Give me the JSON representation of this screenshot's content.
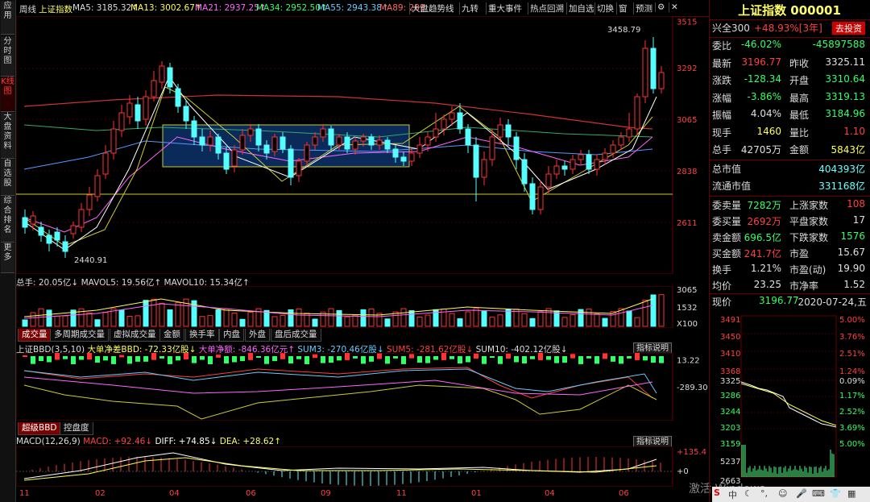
{
  "sidebar": {
    "items": [
      "应用",
      "分时图",
      "K线图",
      "大盘资料",
      "自选股",
      "综合排名",
      "更多"
    ]
  },
  "topbar": {
    "period": "周线",
    "name": "上证指数",
    "ma5": "MA5: 3185.32↑",
    "ma13": "MA13: 3002.67↑",
    "ma21": "MA21: 2937.25↑",
    "ma34": "MA34: 2952.50↑",
    "ma55": "MA55: 2943.38↑",
    "ma89": "MA89: 289",
    "buttons": [
      "大盘趋势线",
      "九转",
      "重大事件",
      "热点回溯",
      "加自选",
      "切换",
      "窗",
      "预测"
    ]
  },
  "main_axis": [
    "3515",
    "3292",
    "3065",
    "2838",
    "2611"
  ],
  "main_annot": {
    "high": "3458.79",
    "low": "2440.91"
  },
  "volume": {
    "title": "总手: 20.05亿↓ MAVOL5: 19.56亿↑ MAVOL10: 15.34亿↑",
    "axis": [
      "3065",
      "1532",
      "X100"
    ]
  },
  "tabs": [
    "成交量",
    "多周期成交量",
    "虚拟成交量",
    "金额",
    "换手率",
    "内盘",
    "外盘",
    "盘后成交量"
  ],
  "bbd": {
    "t1": "上证BBD(3,5,10)",
    "t2": "大单净差BBD: -72.33亿股↓",
    "t3": "大单净额: -846.36亿元↑",
    "t4": "SUM3: -270.46亿股↓",
    "t5": "SUM5: -281.62亿股↓",
    "t6": "SUM10: -402.12亿股↓",
    "axis": [
      "13.22",
      "-289.30"
    ],
    "btn": "指标说明"
  },
  "tabs2": [
    "超级BBD",
    "控盘度"
  ],
  "macd": {
    "t1": "MACD(12,26,9)",
    "t2": "MACD: +92.46↓",
    "t3": "DIFF: +74.85↓",
    "t4": "DEA: +28.62↑",
    "axis": [
      "+135.4",
      "+0"
    ],
    "btn": "指标说明"
  },
  "xaxis": [
    "11",
    "02",
    "04",
    "06",
    "09",
    "11",
    "01",
    "04",
    "06"
  ],
  "watermark": "激活 Windows",
  "right": {
    "title": "上证指数 000001",
    "top_row": {
      "label": "兴全300",
      "value": "+48.93%[3年]",
      "button": "去投资"
    },
    "rows": [
      {
        "l": "委比",
        "v": "-46.02%",
        "vc": "green",
        "l2": "",
        "v2": "-45897588",
        "v2c": "green"
      },
      {
        "l": "最新",
        "v": "3196.77",
        "vc": "red",
        "l2": "昨收",
        "v2": "3325.11",
        "v2c": "white"
      },
      {
        "l": "涨跌",
        "v": "-128.34",
        "vc": "green",
        "l2": "开盘",
        "v2": "3310.64",
        "v2c": "green"
      },
      {
        "l": "涨幅",
        "v": "-3.86%",
        "vc": "green",
        "l2": "最高",
        "v2": "3319.13",
        "v2c": "green"
      },
      {
        "l": "振幅",
        "v": "4.04%",
        "vc": "white",
        "l2": "最低",
        "v2": "3184.96",
        "v2c": "green"
      },
      {
        "l": "现手",
        "v": "1460",
        "vc": "yellow",
        "l2": "量比",
        "v2": "1.10",
        "v2c": "red"
      },
      {
        "l": "总手",
        "v": "42705万",
        "vc": "white",
        "l2": "金额",
        "v2": "5843亿",
        "v2c": "yellow"
      }
    ],
    "cap": [
      {
        "l": "总市值",
        "v": "404393亿"
      },
      {
        "l": "流通市值",
        "v": "331168亿"
      }
    ],
    "rows2": [
      {
        "l": "委卖量",
        "v": "7282万",
        "vc": "green",
        "l2": "上涨家数",
        "v2": "108",
        "v2c": "red"
      },
      {
        "l": "委买量",
        "v": "2692万",
        "vc": "red",
        "l2": "平盘家数",
        "v2": "17",
        "v2c": "white"
      },
      {
        "l": "卖金额",
        "v": "696.5亿",
        "vc": "green",
        "l2": "下跌家数",
        "v2": "1576",
        "v2c": "green"
      },
      {
        "l": "买金额",
        "v": "241.7亿",
        "vc": "red",
        "l2": "市盈",
        "v2": "15.67",
        "v2c": "white"
      },
      {
        "l": "换手",
        "v": "1.21%",
        "vc": "white",
        "l2": "市盈(动)",
        "v2": "19.90",
        "v2c": "white"
      },
      {
        "l": "均价",
        "v": "23.25",
        "vc": "white",
        "l2": "市净率",
        "v2": "1.52",
        "v2c": "white"
      }
    ],
    "now": {
      "l": "现价",
      "v": "3196.77",
      "date": "2020-07-24,五"
    },
    "mini_left": [
      "3491",
      "3450",
      "3410",
      "3368",
      "3325",
      "3286",
      "3244",
      "3203",
      "3159",
      "5237",
      "2663"
    ],
    "mini_right": [
      "5.00%",
      "3.76%",
      "2.51%",
      "1.24%",
      "0.09%",
      "1.17%",
      "2.52%",
      "3.69%",
      "5.00%"
    ]
  }
}
